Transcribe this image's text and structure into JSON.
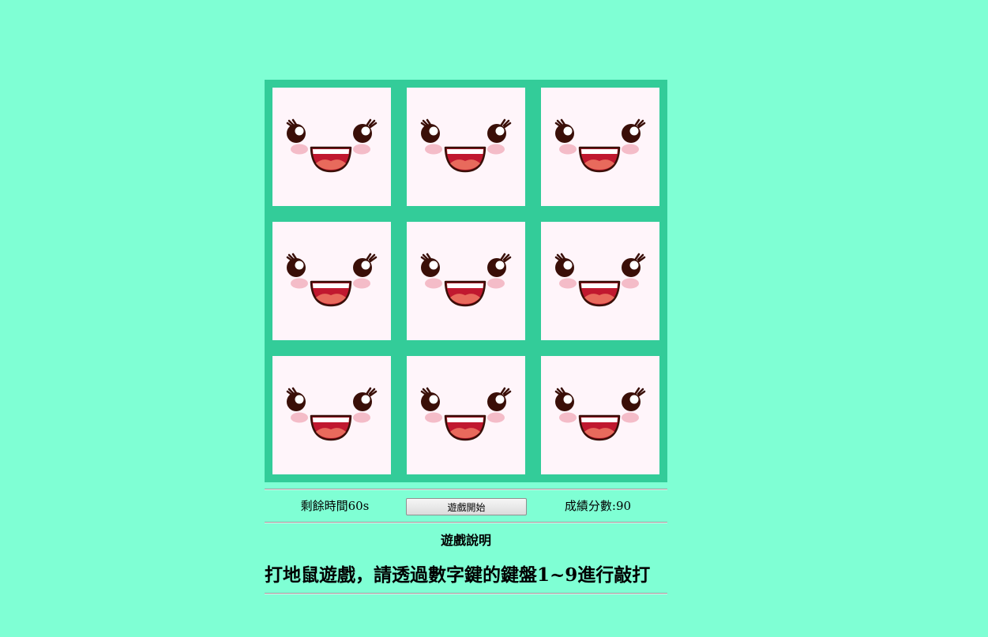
{
  "board": {
    "holes": [
      {
        "key": "1",
        "character": "happy-face-icon"
      },
      {
        "key": "2",
        "character": "happy-face-icon"
      },
      {
        "key": "3",
        "character": "happy-face-icon"
      },
      {
        "key": "4",
        "character": "happy-face-icon"
      },
      {
        "key": "5",
        "character": "happy-face-icon"
      },
      {
        "key": "6",
        "character": "happy-face-icon"
      },
      {
        "key": "7",
        "character": "happy-face-icon"
      },
      {
        "key": "8",
        "character": "happy-face-icon"
      },
      {
        "key": "9",
        "character": "happy-face-icon"
      }
    ]
  },
  "status": {
    "timer_text": "剩餘時間60s",
    "start_label": "遊戲開始",
    "score_text": "成績分數:90"
  },
  "help": {
    "title": "遊戲說明",
    "text": "打地鼠遊戲，請透過數字鍵的鍵盤1~9進行敲打"
  },
  "colors": {
    "page_background": "#7fffd4",
    "board_background": "#33cc99",
    "hole_background": "#fff5fa",
    "face_outline": "#3a0f08",
    "cheek": "#f4bcc8",
    "mouth_inner": "#c0182f",
    "tongue": "#e86a5c"
  }
}
